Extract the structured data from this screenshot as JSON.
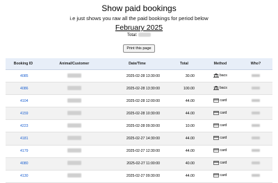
{
  "header": {
    "title": "Show paid bookings",
    "subtitle": "i.e just shows you raw all the paid bookings for period below",
    "month": "February 2025",
    "total_label": "Total:",
    "print_label": "Print this page"
  },
  "table": {
    "columns": [
      "Booking ID",
      "Animal/Customer",
      "Date/Time",
      "Total",
      "Method",
      "Who?"
    ],
    "rows": [
      {
        "id": "4085",
        "datetime": "2025-02-28 13:30:00",
        "total": "30.00",
        "method": "bacs",
        "method_icon": "bank-icon"
      },
      {
        "id": "4086",
        "datetime": "2025-02-28 13:30:00",
        "total": "100.00",
        "method": "bacs",
        "method_icon": "bank-icon"
      },
      {
        "id": "4104",
        "datetime": "2025-02-28 12:00:00",
        "total": "44.00",
        "method": "card",
        "method_icon": "card-icon"
      },
      {
        "id": "4159",
        "datetime": "2025-02-28 10:30:00",
        "total": "44.00",
        "method": "card",
        "method_icon": "card-icon"
      },
      {
        "id": "4223",
        "datetime": "2025-02-28 09:30:00",
        "total": "10.00",
        "method": "card",
        "method_icon": "card-icon"
      },
      {
        "id": "4181",
        "datetime": "2025-02-27 14:30:00",
        "total": "44.00",
        "method": "card",
        "method_icon": "card-icon"
      },
      {
        "id": "4179",
        "datetime": "2025-02-27 12:30:00",
        "total": "44.00",
        "method": "card",
        "method_icon": "card-icon"
      },
      {
        "id": "4080",
        "datetime": "2025-02-27 11:00:00",
        "total": "40.00",
        "method": "card",
        "method_icon": "card-icon"
      },
      {
        "id": "4130",
        "datetime": "2025-02-27 09:30:00",
        "total": "44.00",
        "method": "card",
        "method_icon": "card-icon"
      }
    ]
  },
  "colors": {
    "link": "#1a5fd0",
    "header_bg": "#e7eef8",
    "stripe": "#f2f2f2"
  }
}
